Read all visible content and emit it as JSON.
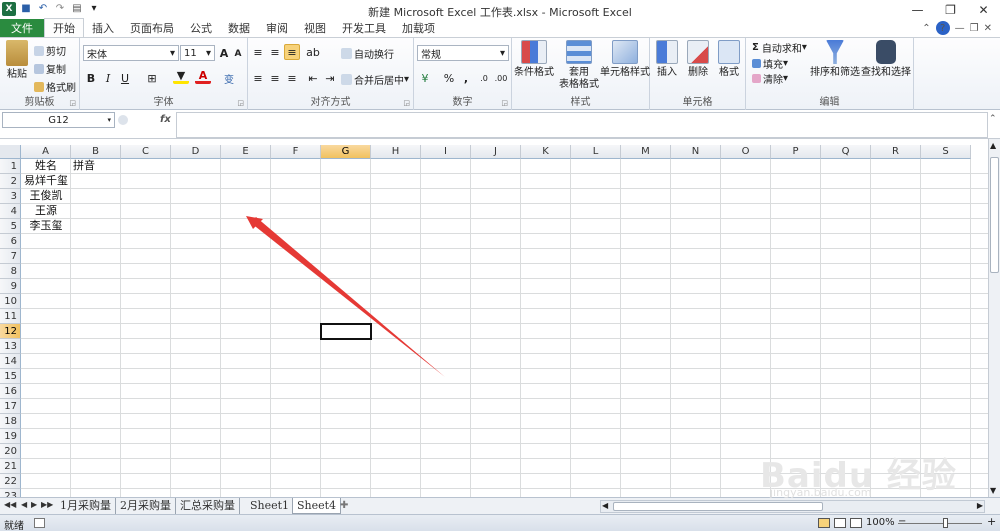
{
  "window": {
    "title": "新建 Microsoft Excel 工作表.xlsx - Microsoft Excel"
  },
  "qat": {
    "undo": "↶",
    "redo": "↷",
    "save": "■",
    "more": "▾"
  },
  "window_controls": {
    "minimize": "—",
    "restore": "❐",
    "close": "✕"
  },
  "tabs": [
    "开始",
    "插入",
    "页面布局",
    "公式",
    "数据",
    "审阅",
    "视图",
    "开发工具",
    "加载项"
  ],
  "file_tab": "文件",
  "clipboard": {
    "paste": "粘贴",
    "cut": "剪切",
    "copy": "复制",
    "format_painter": "格式刷",
    "label": "剪贴板"
  },
  "font": {
    "name": "宋体",
    "size": "11",
    "bold": "B",
    "italic": "I",
    "underline": "U",
    "label": "字体",
    "grow": "A",
    "shrink": "A",
    "wen": "变"
  },
  "alignment": {
    "wrap": "自动换行",
    "merge": "合并后居中",
    "label": "对齐方式"
  },
  "number": {
    "format": "常规",
    "percent": "%",
    "comma": ",",
    "label": "数字",
    "inc": ".0",
    "dec": ".00"
  },
  "styles": {
    "conditional": "条件格式",
    "table_line1": "套用",
    "table_line2": "表格格式",
    "cell_styles": "单元格样式",
    "label": "样式"
  },
  "cells": {
    "insert": "插入",
    "delete": "删除",
    "format": "格式",
    "label": "单元格"
  },
  "editing": {
    "autosum": "自动求和",
    "fill": "填充",
    "clear": "清除",
    "sort": "排序和筛选",
    "find": "查找和选择",
    "label": "编辑",
    "sigma": "Σ"
  },
  "name_box": "G12",
  "fx": "fx",
  "formula_value": "",
  "columns": [
    "A",
    "B",
    "C",
    "D",
    "E",
    "F",
    "G",
    "H",
    "I",
    "J",
    "K",
    "L",
    "M",
    "N",
    "O",
    "P",
    "Q",
    "R",
    "S"
  ],
  "rows": [
    "1",
    "2",
    "3",
    "4",
    "5",
    "6",
    "7",
    "8",
    "9",
    "10",
    "11",
    "12",
    "13",
    "14",
    "15",
    "16",
    "17",
    "18",
    "19",
    "20",
    "21",
    "22",
    "23"
  ],
  "cells_data": {
    "A1": "姓名",
    "B1": "拼音",
    "A2": "易烊千玺",
    "A3": "王俊凯",
    "A4": "王源",
    "A5": "李玉玺"
  },
  "sheets": [
    "1月采购量",
    "2月采购量",
    "汇总采购量",
    "Sheet1",
    "Sheet4"
  ],
  "active_sheet": "Sheet4",
  "status": {
    "ready": "就绪",
    "zoom": "100%"
  },
  "watermark": {
    "text": "Baidu 经验",
    "url": "jingyan.baidu.com"
  },
  "colors": {
    "file_tab": "#2a8b3f",
    "selection_header": "#f1c15f",
    "arrow": "#e53935"
  }
}
